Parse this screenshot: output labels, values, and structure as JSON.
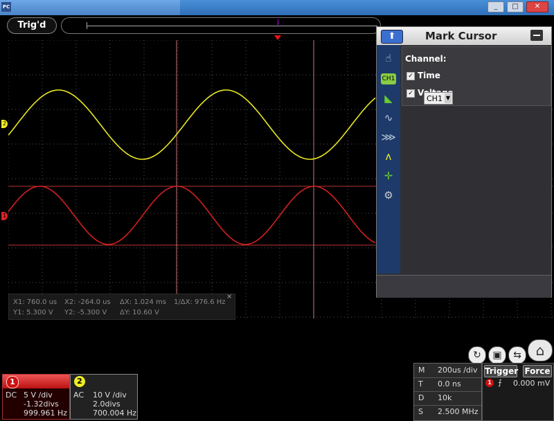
{
  "window": {
    "app_logo": "PC",
    "controls": [
      "_",
      "□",
      "✕"
    ]
  },
  "status": {
    "trigger_state": "Trig'd"
  },
  "cursor_readout": {
    "x1": "X1: 760.0 us",
    "x2": "X2: -264.0 us",
    "dx": "ΔX: 1.024 ms",
    "inv_dx": "1/ΔX: 976.6 Hz",
    "y1": "Y1: 5.300 V",
    "y2": "Y2: -5.300 V",
    "dy": "ΔY: 10.60 V",
    "close": "×"
  },
  "panel": {
    "title": "Mark Cursor",
    "section_label": "Channel:",
    "time_label": "Time",
    "time_checked": true,
    "voltage_label": "Voltage",
    "voltage_checked": true,
    "voltage_channel": "CH1",
    "side_icons": [
      "hand-icon",
      "channel-icon",
      "trigger-icon",
      "math-icon",
      "fft-icon",
      "measure-icon",
      "cursor-icon",
      "settings-icon"
    ]
  },
  "channels": [
    {
      "id": "1",
      "coupling": "DC",
      "scale": "5 V /div",
      "offset": "-1.32divs",
      "freq": "999.961 Hz",
      "color": "#dd2222"
    },
    {
      "id": "2",
      "coupling": "AC",
      "scale": "10 V /div",
      "offset": "2.0divs",
      "freq": "700.004 Hz",
      "color": "#eeee22"
    }
  ],
  "timebase": {
    "rows": [
      {
        "key": "M",
        "value": "200us /div"
      },
      {
        "key": "T",
        "value": "0.0 ns"
      },
      {
        "key": "D",
        "value": "10k"
      },
      {
        "key": "S",
        "value": "2.500 MHz"
      }
    ]
  },
  "trigger": {
    "trigger_label": "Trigger",
    "force_label": "Force",
    "channel": "1",
    "level": "0.000 mV"
  }
}
